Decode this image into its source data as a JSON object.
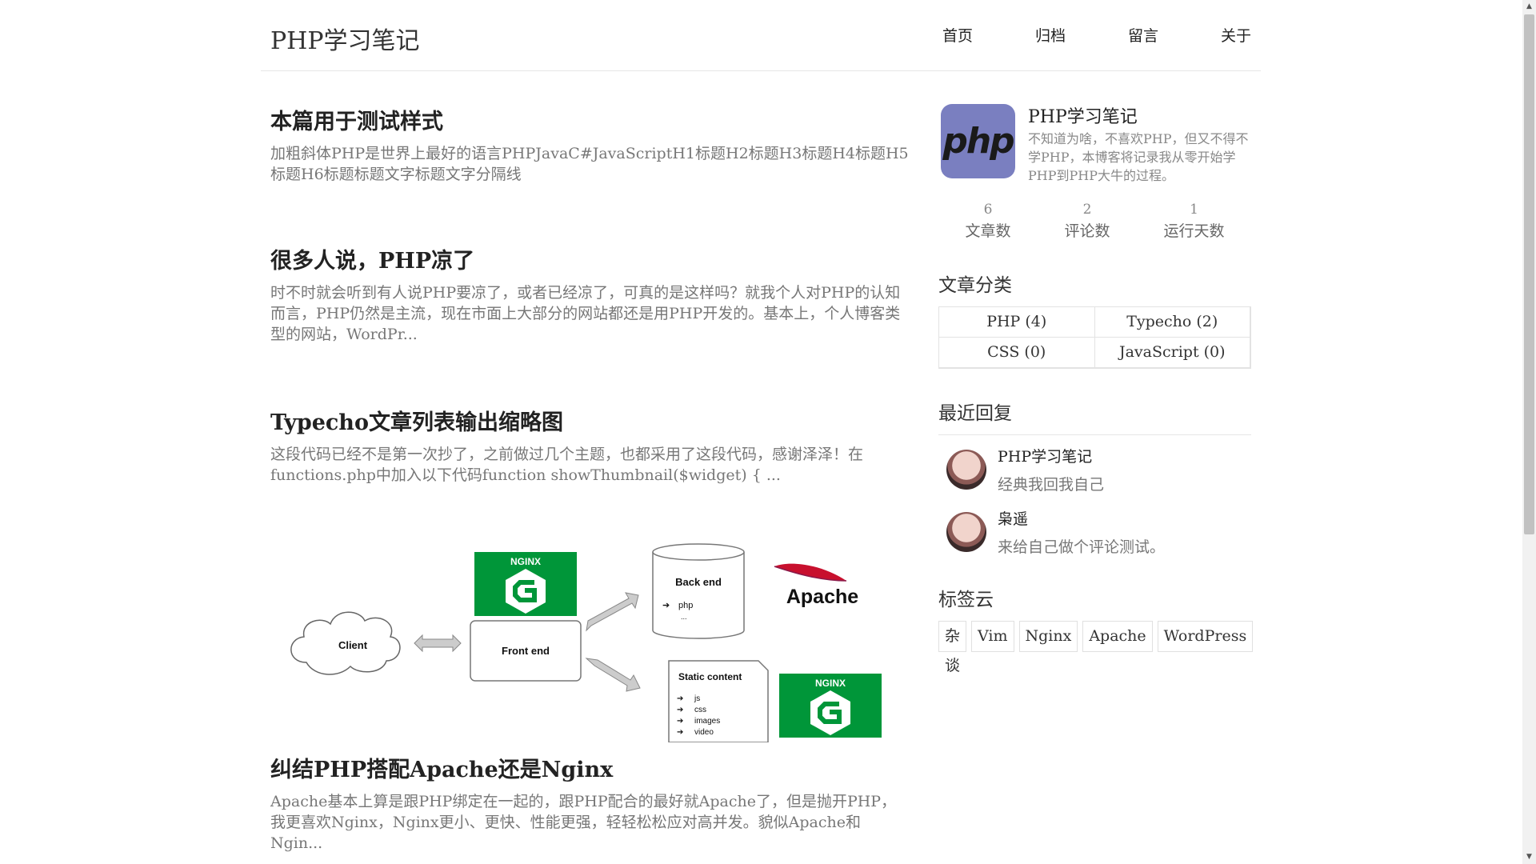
{
  "header": {
    "logo": "PHP学习笔记",
    "nav": [
      "首页",
      "归档",
      "留言",
      "关于"
    ]
  },
  "posts": [
    {
      "title": "本篇用于测试样式",
      "excerpt": "加粗斜体PHP是世界上最好的语言PHPJavaC#JavaScriptH1标题H2标题H3标题H4标题H5标题H6标题标题文字标题文字分隔线"
    },
    {
      "title": "很多人说，PHP凉了",
      "excerpt": "时不时就会听到有人说PHP要凉了，或者已经凉了，可真的是这样吗？就我个人对PHP的认知而言，PHP仍然是主流，现在市面上大部分的网站都还是用PHP开发的。基本上，个人博客类型的网站，WordPr..."
    },
    {
      "title": "Typecho文章列表输出缩略图",
      "excerpt": "这段代码已经不是第一次抄了，之前做过几个主题，也都采用了这段代码，感谢泽泽！在functions.php中加入以下代码function showThumbnail($widget) { ..."
    },
    {
      "title": "纠结PHP搭配Apache还是Nginx",
      "excerpt": "Apache基本上算是跟PHP绑定在一起的，跟PHP配合的最好就Apache了，但是抛开PHP，我更喜欢Nginx，Nginx更小、更快、性能更强，轻轻松松应对高并发。貌似Apache和Ngin..."
    }
  ],
  "thumbnail": {
    "client": "Client",
    "frontend": "Front end",
    "backend": "Back end",
    "backend_item": "php",
    "backend_more": "...",
    "static_title": "Static content",
    "static_items": [
      "js",
      "css",
      "images",
      "video"
    ],
    "nginx": "NGINX",
    "apache": "Apache"
  },
  "profile": {
    "avatar_text": "php",
    "name": "PHP学习笔记",
    "desc": "不知道为啥，不喜欢PHP，但又不得不学PHP，本博客将记录我从零开始学PHP到PHP大牛的过程。",
    "stats": [
      {
        "num": "6",
        "label": "文章数"
      },
      {
        "num": "2",
        "label": "评论数"
      },
      {
        "num": "1",
        "label": "运行天数"
      }
    ]
  },
  "categories": {
    "title": "文章分类",
    "items": [
      "PHP (4)",
      "Typecho (2)",
      "CSS (0)",
      "JavaScript (0)"
    ]
  },
  "recent_replies": {
    "title": "最近回复",
    "items": [
      {
        "name": "PHP学习笔记",
        "text": "经典我回我自己"
      },
      {
        "name": "枭遥",
        "text": "来给自己做个评论测试。"
      }
    ]
  },
  "tag_cloud": {
    "title": "标签云",
    "items": [
      "杂谈",
      "Vim",
      "Nginx",
      "Apache",
      "WordPress"
    ]
  },
  "colors": {
    "nginx_green": "#009639",
    "apache_red": "#c8102e"
  }
}
